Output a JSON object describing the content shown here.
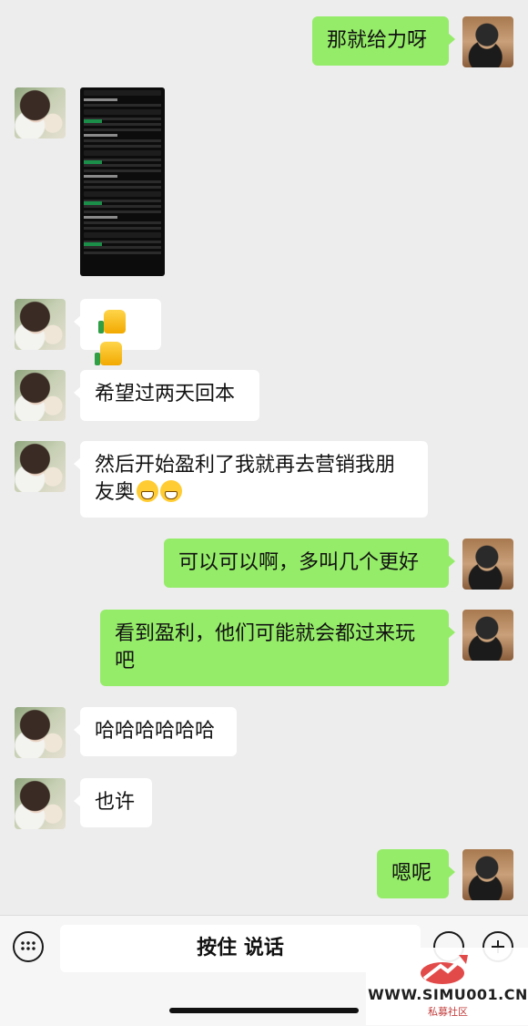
{
  "messages": [
    {
      "side": "right",
      "text": "那就给力呀"
    },
    {
      "side": "left",
      "type": "image"
    },
    {
      "side": "left",
      "type": "thumbs"
    },
    {
      "side": "left",
      "text": "希望过两天回本"
    },
    {
      "side": "left",
      "text": "然后开始盈利了我就再去营销我朋友奥"
    },
    {
      "side": "right",
      "text": "可以可以啊，多叫几个更好"
    },
    {
      "side": "right",
      "text": "看到盈利，他们可能就会都过来玩吧"
    },
    {
      "side": "left",
      "text": "哈哈哈哈哈哈"
    },
    {
      "side": "left",
      "text": "也许"
    },
    {
      "side": "right",
      "text": "嗯呢"
    }
  ],
  "input": {
    "hold_to_talk": "按住 说话"
  },
  "watermark": {
    "url": "WWW.SIMU001.CN",
    "sub": "私募社区"
  },
  "icons": {
    "keyboard": "keyboard-icon",
    "emoji": "emoji-icon",
    "plus": "plus-icon",
    "thumbs": "thumbs-up-icon",
    "grin": "grin-emoji-icon"
  }
}
